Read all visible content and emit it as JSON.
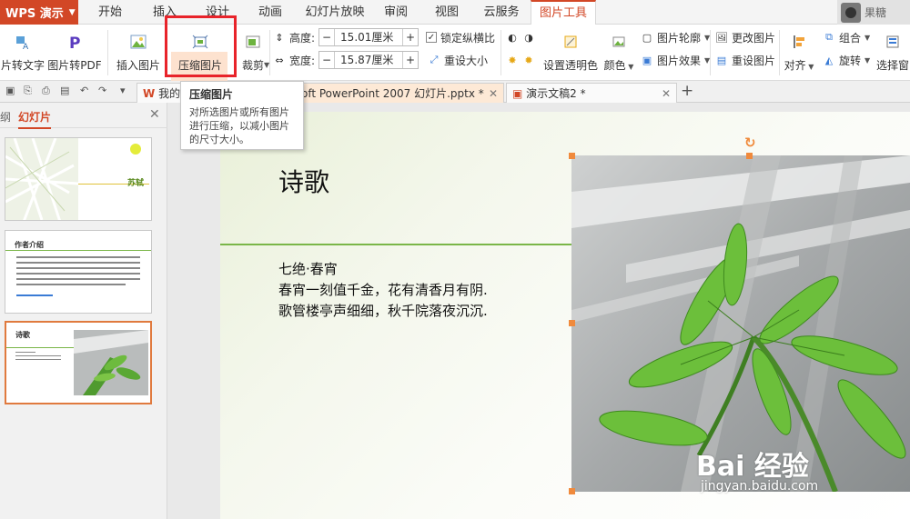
{
  "app": {
    "name": "WPS 演示"
  },
  "menu_tabs": [
    "开始",
    "插入",
    "设计",
    "动画",
    "幻灯片放映",
    "审阅",
    "视图",
    "云服务",
    "图片工具"
  ],
  "user": {
    "name": "果糖"
  },
  "ribbon": {
    "pic_to_text": "片转文字",
    "pic_to_pdf": "图片转PDF",
    "insert_picture": "插入图片",
    "compress_picture": "压缩图片",
    "crop": "裁剪",
    "height_label": "高度:",
    "height_value": "15.01厘米",
    "width_label": "宽度:",
    "width_value": "15.87厘米",
    "lock_ratio": "锁定纵横比",
    "reset_size": "重设大小",
    "set_transparent": "设置透明色",
    "color": "颜色",
    "picture_outline": "图片轮廓",
    "picture_effects": "图片效果",
    "change_picture": "更改图片",
    "reset_picture": "重设图片",
    "align": "对齐",
    "group": "组合",
    "rotate": "旋转",
    "selection_pane": "选择窗"
  },
  "tooltip": {
    "title": "压缩图片",
    "body": "对所选图片或所有图片进行压缩，以减小图片的尺寸大小。"
  },
  "doc_tabs": [
    {
      "label": "我的",
      "active": false
    },
    {
      "label": "oft PowerPoint 2007 幻灯片.pptx *",
      "active": true
    },
    {
      "label": "演示文稿2 *",
      "active": false
    }
  ],
  "panel": {
    "outline_tab": "纲",
    "slides_tab": "幻灯片",
    "thumbs": [
      {
        "index": 1,
        "author": "苏轼"
      },
      {
        "index": 2,
        "title": "作者介绍"
      },
      {
        "index": 3,
        "title": "诗歌"
      }
    ]
  },
  "slide": {
    "title": "诗歌",
    "lines": [
      "七绝·春宵",
      "春宵一刻值千金，花有清香月有阴.",
      "歌管楼亭声细细，秋千院落夜沉沉."
    ]
  },
  "watermark": {
    "text": "Bai  经验",
    "url": "jingyan.baidu.com"
  },
  "colors": {
    "accent": "#d24726",
    "highlight": "#e8232a",
    "green": "#7ab648",
    "handle": "#f08a3c"
  }
}
